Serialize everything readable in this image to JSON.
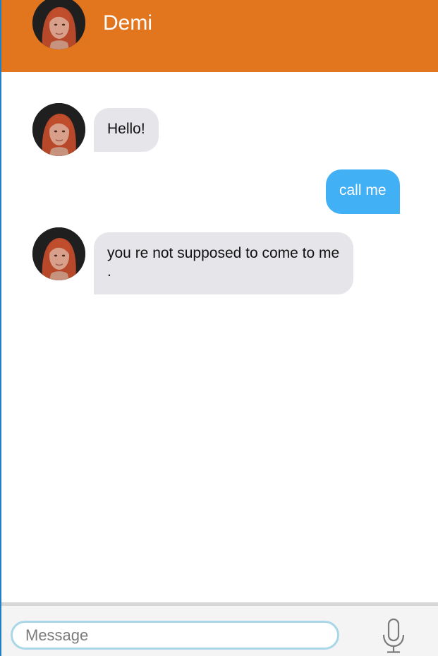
{
  "header": {
    "name": "Demi"
  },
  "messages": [
    {
      "from": "bot",
      "text": "Hello!"
    },
    {
      "from": "user",
      "text": "call me"
    },
    {
      "from": "bot",
      "text": "you re not supposed to come to me ."
    }
  ],
  "composer": {
    "placeholder": "Message",
    "value": "",
    "mic_icon": "microphone-icon"
  },
  "colors": {
    "header_bg": "#e2761f",
    "incoming_bubble": "#e5e5ea",
    "outgoing_bubble": "#42b0f4"
  }
}
